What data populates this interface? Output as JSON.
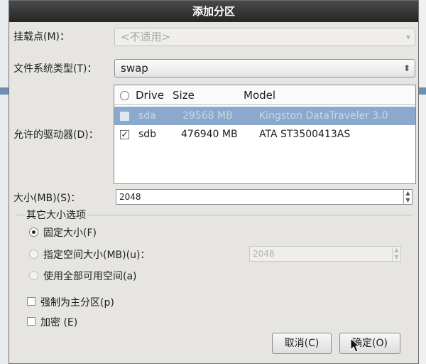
{
  "dialog": {
    "title": "添加分区"
  },
  "mount_point": {
    "label": "挂载点(M)：",
    "value": "<不适用>"
  },
  "fs_type": {
    "label": "文件系统类型(T)：",
    "value": "swap"
  },
  "drives": {
    "label": "允许的驱动器(D)：",
    "headers": {
      "drive": "Drive",
      "size": "Size",
      "model": "Model"
    },
    "rows": [
      {
        "drive": "sda",
        "size": "29568 MB",
        "model": "Kingston DataTraveler 3.0",
        "checked": false,
        "selected": true
      },
      {
        "drive": "sdb",
        "size": "476940 MB",
        "model": "ATA ST3500413AS",
        "checked": true,
        "selected": false
      }
    ]
  },
  "size": {
    "label": "大小(MB)(S)：",
    "value": "2048"
  },
  "size_options": {
    "title": "其它大小选项",
    "fixed": "固定大小(F)",
    "up_to": "指定空间大小(MB)(u)：",
    "up_to_value": "2048",
    "fill_all": "使用全部可用空间(a)"
  },
  "primary": {
    "label": "强制为主分区(p)",
    "checked": false
  },
  "encrypt": {
    "label": "加密 (E)",
    "checked": false
  },
  "buttons": {
    "cancel": "取消(C)",
    "ok": "确定(O)"
  },
  "icons": {
    "combo_arrow": "chevron-down-icon",
    "combo_updown": "up-down-arrows-icon",
    "check": "checkmark-icon",
    "pointer": "mouse-pointer-icon"
  }
}
